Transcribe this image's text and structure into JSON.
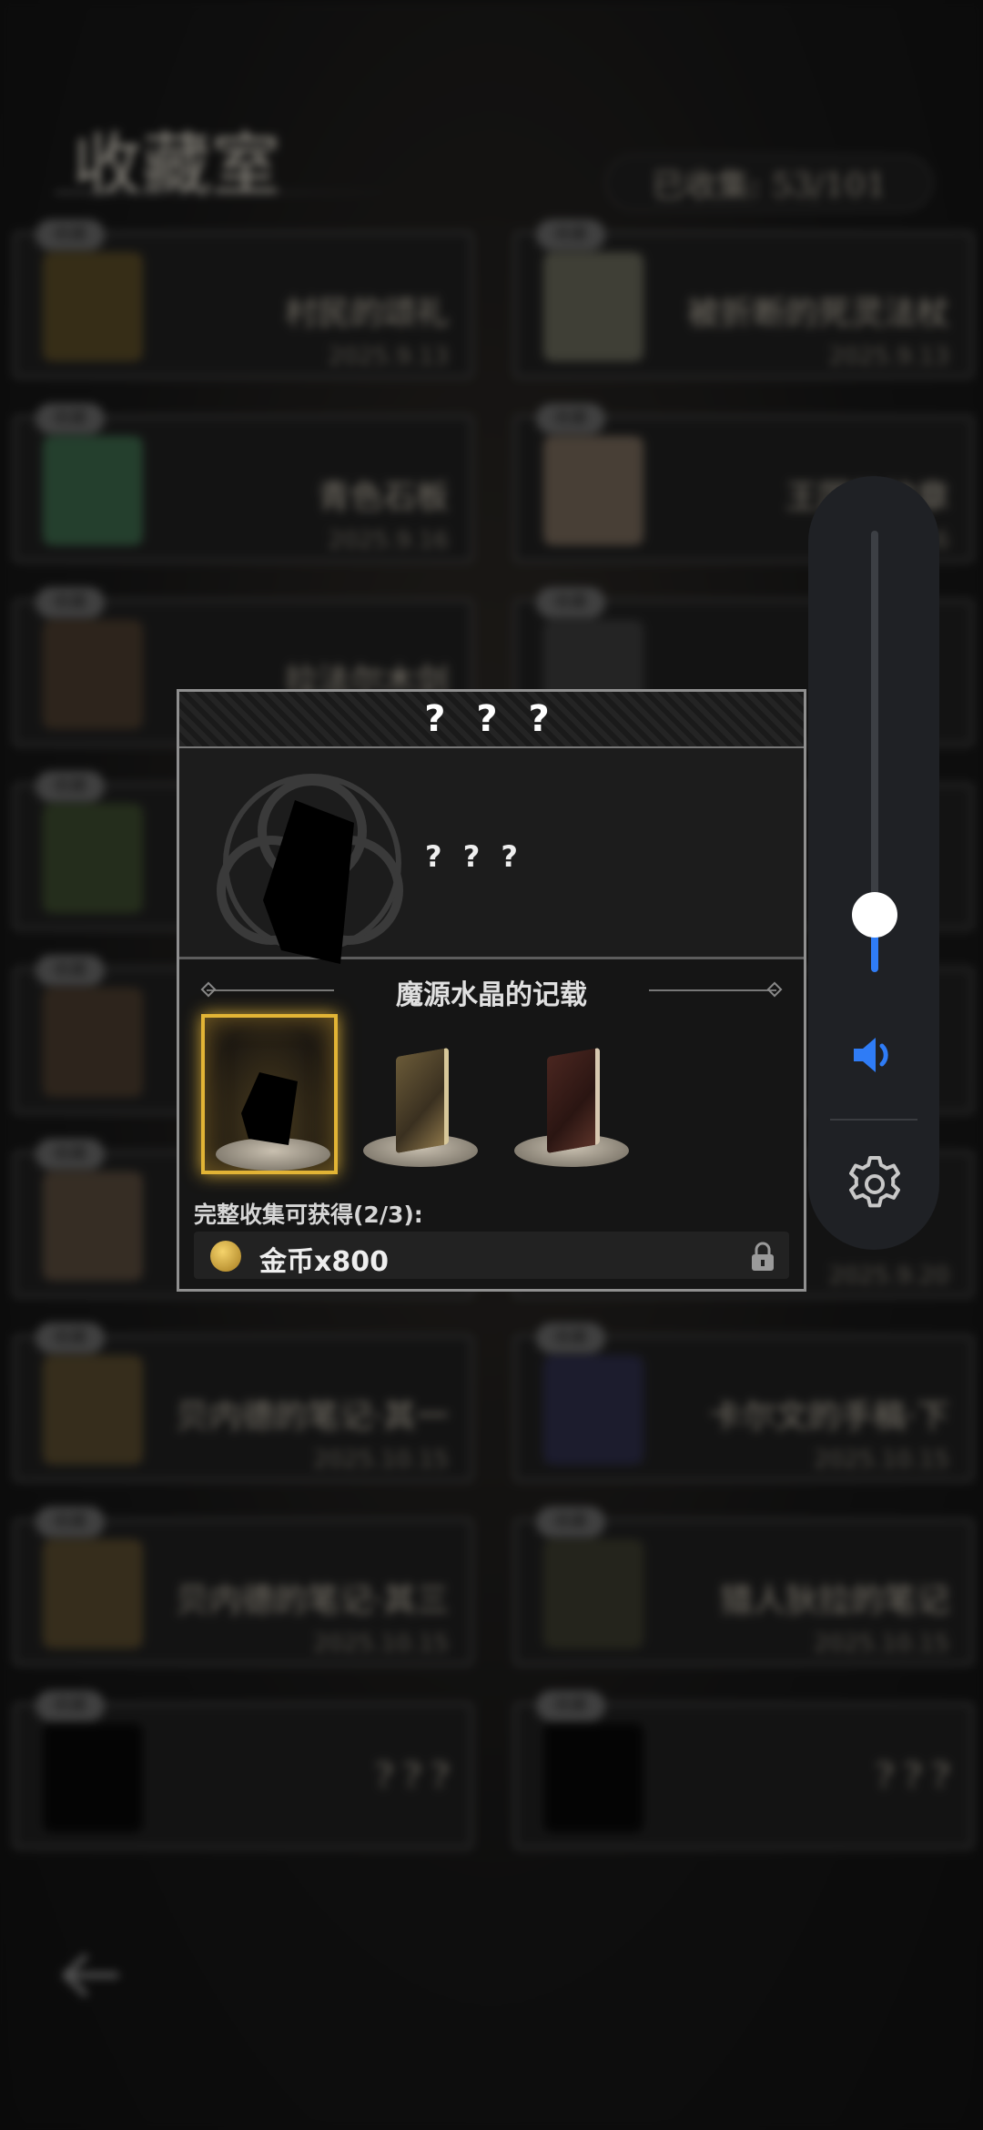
{
  "background": {
    "title": "收藏室",
    "collected": "已收集: 53/101",
    "cards": [
      {
        "name": "村民的颂礼",
        "date": "2025.9.13",
        "tag": "收藏"
      },
      {
        "name": "被折断的死灵法杖",
        "date": "2025.9.13",
        "tag": "收藏"
      },
      {
        "name": "青色石板",
        "date": "2025.9.16",
        "tag": "收藏"
      },
      {
        "name": "王国的纹章",
        "date": "2025.9.16",
        "tag": "收藏"
      },
      {
        "name": "拉法尔木剑",
        "date": "",
        "tag": "收藏"
      },
      {
        "name": "",
        "date": "",
        "tag": "收藏"
      },
      {
        "name": "",
        "date": "",
        "tag": "收藏"
      },
      {
        "name": "",
        "date": "",
        "tag": "收藏"
      },
      {
        "name": "",
        "date": "",
        "tag": "收藏"
      },
      {
        "name": "",
        "date": "",
        "tag": "收藏"
      },
      {
        "name": "",
        "date": "",
        "tag": "收藏"
      },
      {
        "name": "",
        "date": "2025.9.20",
        "tag": "收藏"
      },
      {
        "name": "贝内德的笔记·其一",
        "date": "2025.10.15",
        "tag": "收藏"
      },
      {
        "name": "卡尔文的手稿·下",
        "date": "2025.10.15",
        "tag": "收藏"
      },
      {
        "name": "贝内德的笔记·其三",
        "date": "2025.10.15",
        "tag": "收藏"
      },
      {
        "name": "猎人狄拉的笔记",
        "date": "2025.10.15",
        "tag": "收藏"
      },
      {
        "name": "? ? ?",
        "date": "",
        "tag": "收藏"
      },
      {
        "name": "? ? ?",
        "date": "",
        "tag": "收藏"
      }
    ]
  },
  "popup": {
    "header": "? ? ?",
    "item_name": "? ? ?",
    "set_title": "魔源水晶的记载",
    "reward_label": "完整收集可获得(2/3):",
    "reward_text": "金币x800"
  },
  "volume": {
    "level": 0.13,
    "accent": "#2f7cf6"
  },
  "icons": [
    "speaker-icon",
    "gear-icon",
    "lock-icon",
    "coin-icon",
    "back-arrow-icon"
  ]
}
